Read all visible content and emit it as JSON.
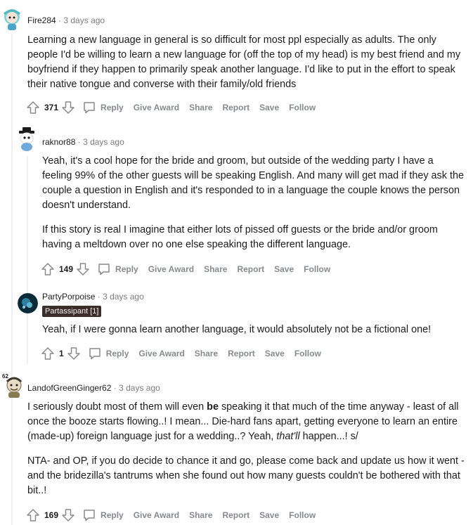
{
  "comments": [
    {
      "username": "Fire284",
      "time": "3 days ago",
      "paragraphs": [
        "Learning a new language in general is so difficult for most ppl especially as adults. The only people I'd be willing to learn a new language for (off the top of my head) is my best friend and my boyfriend if they happen to primarily speak another language. I'd like to put in the effort to speak their native tongue and converse with their family/old friends"
      ],
      "score": "371"
    },
    {
      "username": "raknor88",
      "time": "3 days ago",
      "paragraphs": [
        "Yeah, it's a cool hope for the bride and groom, but outside of the wedding party I have a feeling 99% of the other guests will be speaking English. And many will get mad if they ask the couple a question in English and it's responded to in a language the couple knows the person doesn't understand.",
        "If this story is real I imagine that either lots of pissed off guests or the bride and/or groom having a meltdown over no one else speaking the different language."
      ],
      "score": "149"
    },
    {
      "username": "PartyPorpoise",
      "time": "3 days ago",
      "flair": "Partassipant [1]",
      "paragraphs": [
        "Yeah, if I were gonna learn another language, it would absolutely not be a fictional one!"
      ],
      "score": "1"
    },
    {
      "username": "LandofGreenGinger62",
      "time": "3 days ago",
      "avatar_badge": "62",
      "p1": {
        "a": "I seriously doubt most of them will even ",
        "bold": "be",
        "b": " speaking it that much of the time anyway - least of all once the booze starts flowing..! I mean... Die-hard fans apart, getting everyone to learn an entire (made-up) foreign language just for a wedding..? Yeah, ",
        "italic": "that'll",
        "c": " happen...! s/"
      },
      "p2": "NTA- and OP, if you do decide to chance it and go, please come back and update us how it went - and the bridezilla's tantrums when she found out how many guests couldn't be bothered with that bit..!",
      "score": "169"
    }
  ],
  "actions": {
    "reply": "Reply",
    "give_award": "Give Award",
    "share": "Share",
    "report": "Report",
    "save": "Save",
    "follow": "Follow"
  },
  "meta_separator": "·",
  "colors": {
    "thread_line": "#edeff1",
    "action_text": "#878a8c",
    "flair_bg": "#3b2e2a"
  }
}
